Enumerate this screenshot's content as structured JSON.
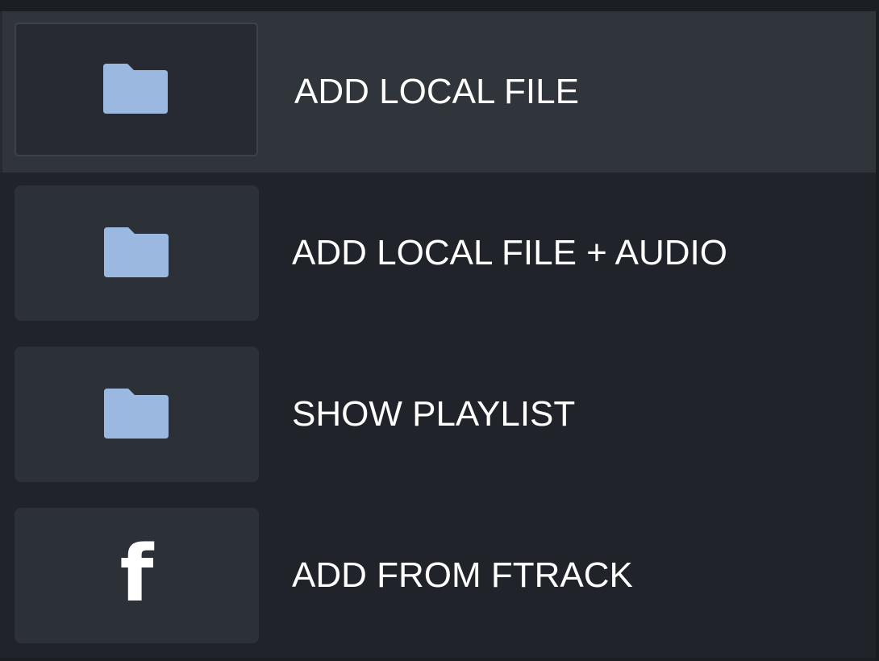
{
  "menu": {
    "items": [
      {
        "label": "ADD LOCAL FILE",
        "icon": "folder-icon",
        "active": true
      },
      {
        "label": "ADD LOCAL FILE + AUDIO",
        "icon": "folder-icon",
        "active": false
      },
      {
        "label": "SHOW PLAYLIST",
        "icon": "folder-icon",
        "active": false
      },
      {
        "label": "ADD FROM FTRACK",
        "icon": "ftrack-icon",
        "icon_glyph": "f",
        "active": false
      }
    ]
  },
  "colors": {
    "background": "#20242a",
    "active_row": "#30343b",
    "tile": "#2c3037",
    "folder_icon": "#9ab8e0",
    "text": "#ffffff"
  }
}
